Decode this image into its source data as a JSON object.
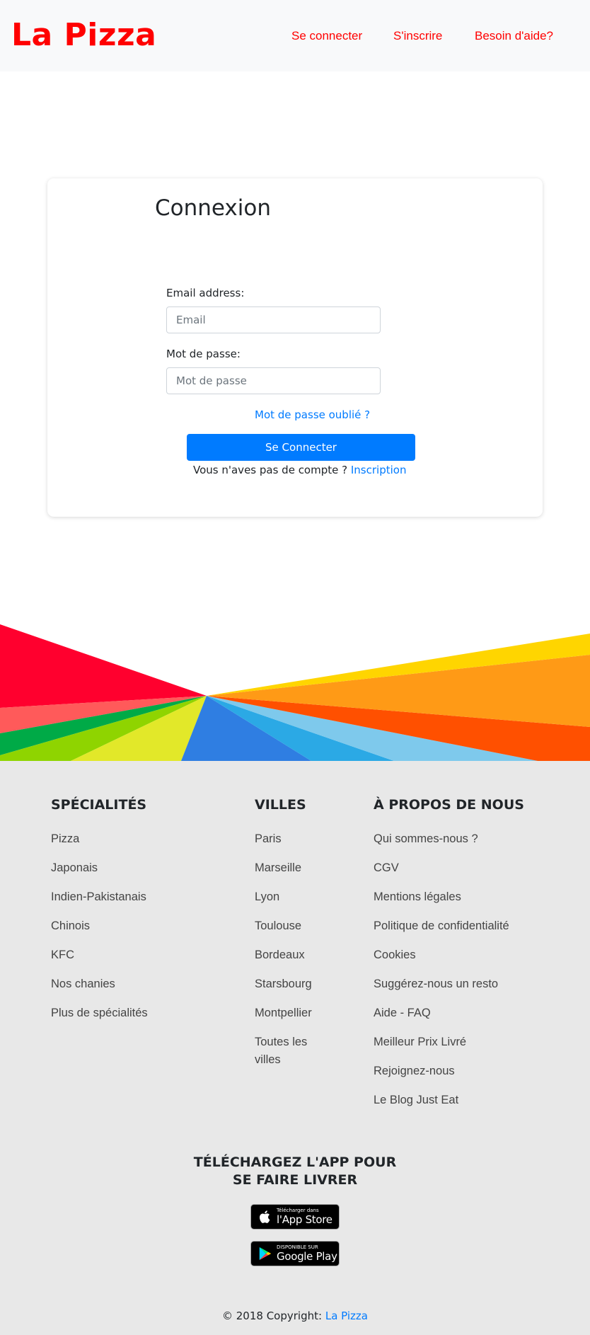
{
  "header": {
    "brand": "La Pizza",
    "nav": [
      {
        "label": "Se connecter"
      },
      {
        "label": "S'inscrire"
      },
      {
        "label": "Besoin d'aide?"
      }
    ],
    "nav_color": "#ff0000"
  },
  "login": {
    "title": "Connexion",
    "email": {
      "label": "Email address:",
      "placeholder": "Email",
      "value": ""
    },
    "password": {
      "label": "Mot de passe:",
      "placeholder": "Mot de passe",
      "value": ""
    },
    "forgot": "Mot de passe oublié ?",
    "submit": "Se Connecter",
    "no_account": "Vous n'aves pas de compte ?",
    "signup_link": "Inscription",
    "accent_color": "#007bff"
  },
  "footer": {
    "columns": [
      {
        "title": "SPÉCIALITÉS",
        "items": [
          "Pizza",
          "Japonais",
          "Indien-Pakistanais",
          "Chinois",
          "KFC",
          "Nos chanies",
          "Plus de spécialités"
        ]
      },
      {
        "title": "VILLES",
        "items": [
          "Paris",
          "Marseille",
          "Lyon",
          "Toulouse",
          "Bordeaux",
          "Starsbourg",
          "Montpellier",
          "Toutes les villes"
        ]
      },
      {
        "title": "À PROPOS DE NOUS",
        "items": [
          "Qui sommes-nous ?",
          "CGV",
          "Mentions légales",
          "Politique de confidentialité",
          "Cookies",
          "Suggérez-nous un resto",
          "Aide - FAQ",
          "Meilleur Prix Livré",
          "Rejoignez-nous",
          "Le Blog Just Eat"
        ]
      }
    ],
    "app_title": "TÉLÉCHARGEZ L'APP POUR SE FAIRE LIVRER",
    "app_store": {
      "small": "Télécharger dans",
      "big": "l'App Store",
      "icon": "apple-icon"
    },
    "google_play": {
      "small": "DISPONIBLE SUR",
      "big": "Google Play",
      "icon": "google-play-icon"
    },
    "copyright_prefix": "© 2018 Copyright:",
    "copyright_link": "La Pizza"
  }
}
